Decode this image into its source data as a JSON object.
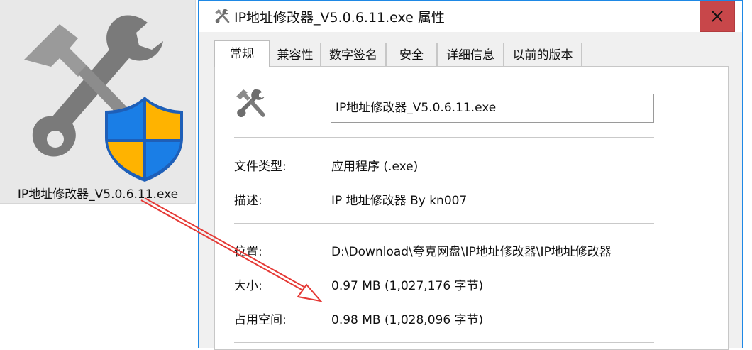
{
  "file_tile": {
    "file_name": "IP地址修改器_V5.0.6.11.exe",
    "icon": "tools-shield-icon"
  },
  "dialog": {
    "title": "IP地址修改器_V5.0.6.11.exe 属性",
    "title_icon": "tools-icon",
    "close_icon": "close-icon",
    "close_color": "#c8474a",
    "tabs": [
      {
        "label": "常规",
        "active": true
      },
      {
        "label": "兼容性",
        "active": false
      },
      {
        "label": "数字签名",
        "active": false
      },
      {
        "label": "安全",
        "active": false
      },
      {
        "label": "详细信息",
        "active": false
      },
      {
        "label": "以前的版本",
        "active": false
      }
    ],
    "general": {
      "file_name_value": "IP地址修改器_V5.0.6.11.exe",
      "rows": [
        {
          "label": "文件类型:",
          "value": "应用程序 (.exe)"
        },
        {
          "label": "描述:",
          "value": "IP 地址修改器 By kn007"
        },
        {
          "label": "位置:",
          "value": "D:\\Download\\夸克网盘\\IP地址修改器\\IP地址修改器"
        },
        {
          "label": "大小:",
          "value": "0.97 MB (1,027,176 字节)"
        },
        {
          "label": "占用空间:",
          "value": "0.98 MB (1,028,096 字节)"
        }
      ]
    }
  },
  "annotation": {
    "arrow_color": "#e53935"
  }
}
